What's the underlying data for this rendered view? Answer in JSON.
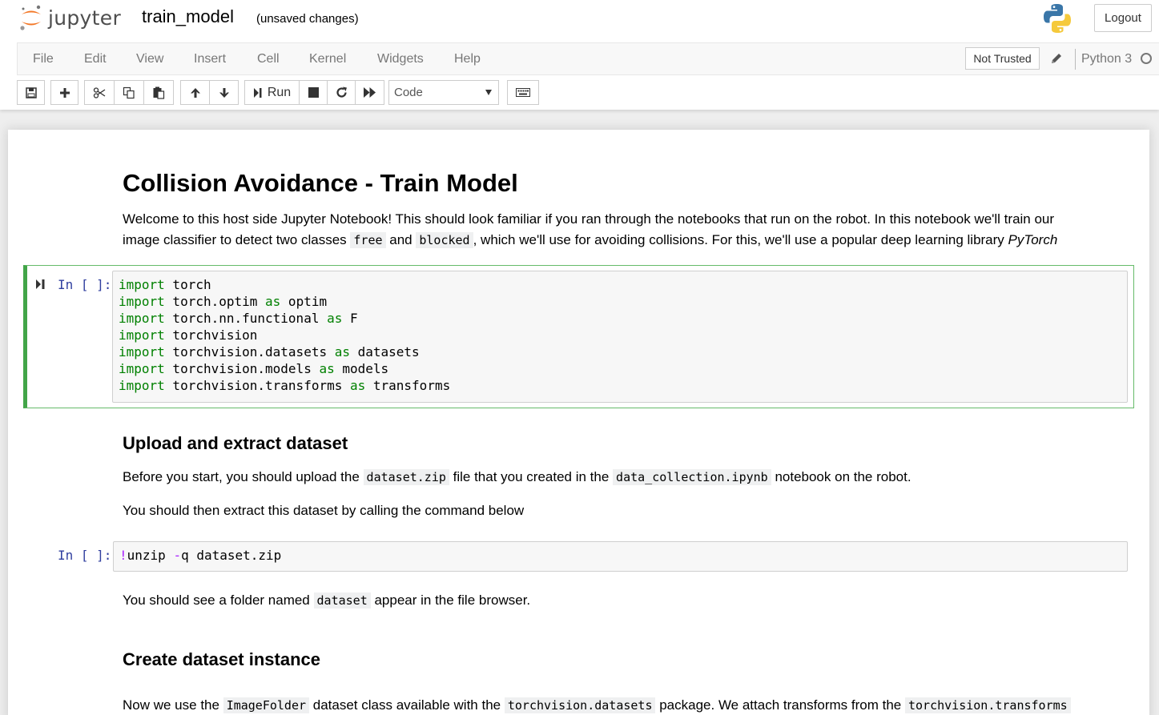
{
  "header": {
    "logo_text": "jupyter",
    "notebook_name": "train_model",
    "save_status": "(unsaved changes)",
    "logout_label": "Logout"
  },
  "menubar": {
    "items": [
      "File",
      "Edit",
      "View",
      "Insert",
      "Cell",
      "Kernel",
      "Widgets",
      "Help"
    ],
    "trusted_label": "Not Trusted",
    "kernel_name": "Python 3"
  },
  "toolbar": {
    "run_label": "Run",
    "cell_type": "Code",
    "buttons": [
      "save-icon",
      "plus-icon",
      "scissors-icon",
      "copy-icon",
      "paste-icon",
      "arrow-up-icon",
      "arrow-down-icon",
      "run-icon",
      "stop-icon",
      "restart-icon",
      "fast-forward-icon",
      "keyboard-icon"
    ]
  },
  "colors": {
    "selected_border": "#42a548",
    "keyword": "#008000",
    "prompt": "#303f9f",
    "magic": "#aa22ff"
  },
  "cells": {
    "title": "Collision Avoidance - Train Model",
    "intro_1": "Welcome to this host side Jupyter Notebook! This should look familiar if you ran through the notebooks that run on the robot. In this notebook we'll train our",
    "intro_2a": "image classifier to detect two classes",
    "intro_code_free": "free",
    "intro_2b": "and",
    "intro_code_blocked": "blocked",
    "intro_2c": ", which we'll use for avoiding collisions. For this, we'll use a popular deep learning library",
    "intro_2d": "PyTorch",
    "prompt_1": "In [ ]:",
    "code_1": [
      {
        "kw": "import",
        "rest": " torch"
      },
      {
        "kw": "import",
        "rest": " torch.optim ",
        "kw2": "as",
        "rest2": " optim"
      },
      {
        "kw": "import",
        "rest": " torch.nn.functional ",
        "kw2": "as",
        "rest2": " F"
      },
      {
        "kw": "import",
        "rest": " torchvision"
      },
      {
        "kw": "import",
        "rest": " torchvision.datasets ",
        "kw2": "as",
        "rest2": " datasets"
      },
      {
        "kw": "import",
        "rest": " torchvision.models ",
        "kw2": "as",
        "rest2": " models"
      },
      {
        "kw": "import",
        "rest": " torchvision.transforms ",
        "kw2": "as",
        "rest2": " transforms"
      }
    ],
    "h2_upload": "Upload and extract dataset",
    "upload_a": "Before you start, you should upload the",
    "upload_code_zip": "dataset.zip",
    "upload_b": "file that you created in the",
    "upload_code_nb": "data_collection.ipynb",
    "upload_c": "notebook on the robot.",
    "extract_text": "You should then extract this dataset by calling the command below",
    "prompt_2": "In [ ]:",
    "code_2_bang": "!",
    "code_2_cmd": "unzip ",
    "code_2_flag": "-",
    "code_2_rest": "q dataset.zip",
    "see_a": "You should see a folder named",
    "see_code": "dataset",
    "see_b": "appear in the file browser.",
    "h2_create": "Create dataset instance",
    "create_a": "Now we use the",
    "create_code_if": "ImageFolder",
    "create_b": "dataset class available with the",
    "create_code_ds": "torchvision.datasets",
    "create_c": "package. We attach transforms from the",
    "create_code_tr": "torchvision.transforms"
  }
}
